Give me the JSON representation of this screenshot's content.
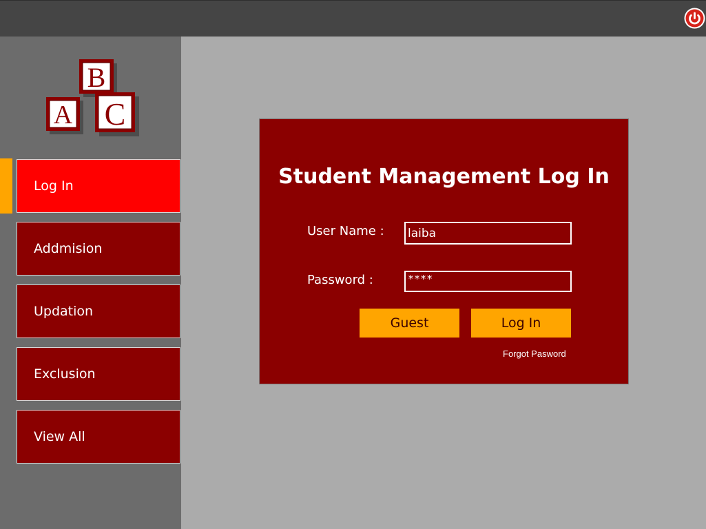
{
  "topbar": {
    "power_icon": "power-icon"
  },
  "sidebar": {
    "logo": {
      "letters": [
        "A",
        "B",
        "C"
      ]
    },
    "items": [
      {
        "label": "Log In",
        "active": true
      },
      {
        "label": "Addmision",
        "active": false
      },
      {
        "label": "Updation",
        "active": false
      },
      {
        "label": "Exclusion",
        "active": false
      },
      {
        "label": "View All",
        "active": false
      }
    ]
  },
  "login": {
    "title": "Student Management Log In",
    "username_label": "User Name :",
    "username_value": "laiba",
    "password_label": "Password :",
    "password_value": "****",
    "guest_label": "Guest",
    "login_label": "Log In",
    "forgot_label": "Forgot Pasword"
  },
  "colors": {
    "accent": "#8b0000",
    "active": "#ff0000",
    "button": "#ffa500",
    "topbar": "#454545",
    "sidebar": "#6c6c6c",
    "main": "#ababab"
  }
}
